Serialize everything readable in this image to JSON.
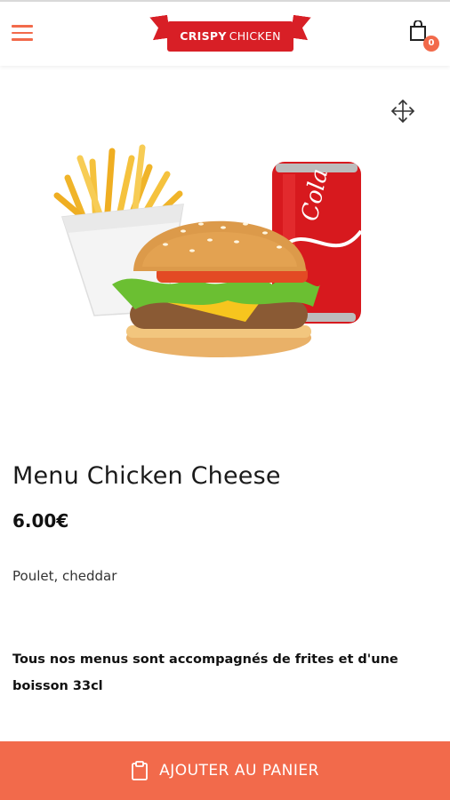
{
  "header": {
    "logo": {
      "word1": "CRISPY",
      "word2": "CHICKEN"
    },
    "cart": {
      "count": "0",
      "icon": "shopping-bag-icon"
    },
    "menu_icon": "hamburger-icon"
  },
  "product": {
    "title": "Menu Chicken Cheese",
    "price": "6.00€",
    "description": "Poulet, cheddar",
    "note": "Tous nos menus sont accompagnés de frites et d'une boisson 33cl"
  },
  "actions": {
    "add_to_cart_label": "AJOUTER AU PANIER",
    "add_to_cart_icon": "clipboard-icon"
  },
  "colors": {
    "accent": "#f26a4b",
    "logo_red": "#d81f26",
    "text": "#1a1a1a"
  }
}
